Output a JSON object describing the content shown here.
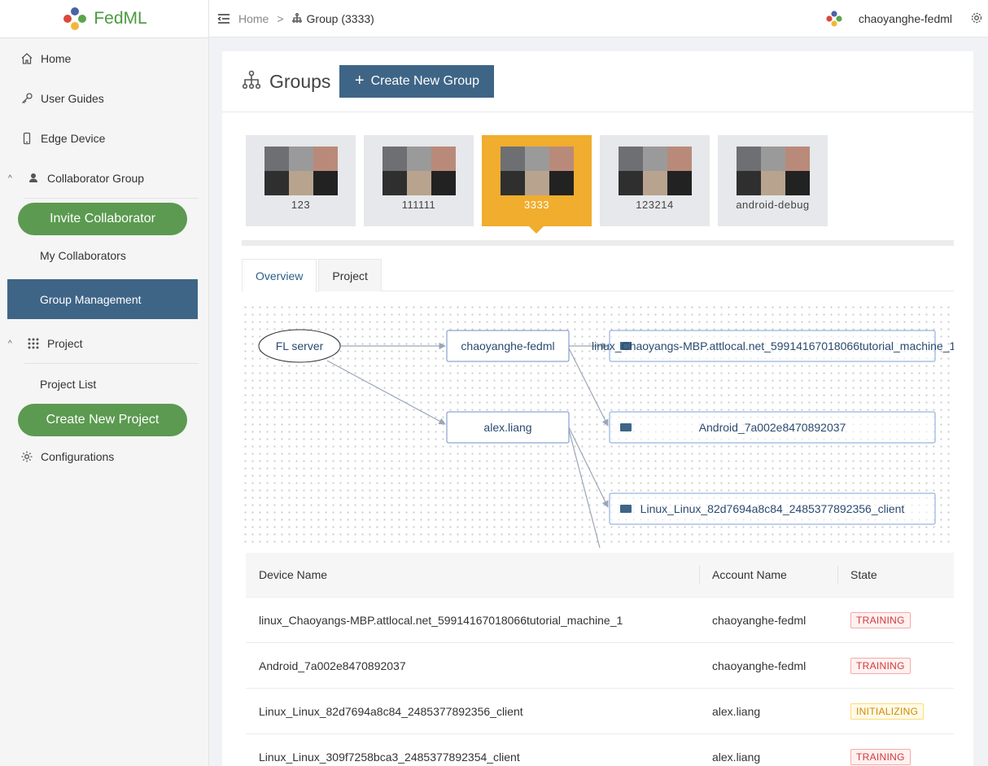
{
  "app": {
    "logo_text": "FedML",
    "brand_colors": {
      "blue": "#4b62a8",
      "green": "#5aa64a",
      "red": "#d9493b",
      "yellow": "#f0b83a"
    }
  },
  "sidebar": {
    "home": "Home",
    "user_guides": "User Guides",
    "edge_device": "Edge Device",
    "collaborator_group": "Collaborator Group",
    "invite_collaborator": "Invite Collaborator",
    "my_collaborators": "My Collaborators",
    "group_management": "Group Management",
    "project": "Project",
    "project_list": "Project List",
    "create_new_project": "Create New Project",
    "configurations": "Configurations"
  },
  "topbar": {
    "home": "Home",
    "separator": ">",
    "current": "Group (3333)",
    "user": "chaoyanghe-fedml"
  },
  "page": {
    "title": "Groups",
    "create_button": "Create New Group"
  },
  "groups": [
    {
      "name": "123",
      "active": false
    },
    {
      "name": "111111",
      "active": false
    },
    {
      "name": "3333",
      "active": true
    },
    {
      "name": "123214",
      "active": false
    },
    {
      "name": "android-debug",
      "active": false
    }
  ],
  "tabs": [
    {
      "label": "Overview",
      "active": true
    },
    {
      "label": "Project",
      "active": false
    }
  ],
  "graph": {
    "server": "FL server",
    "users": [
      "chaoyanghe-fedml",
      "alex.liang"
    ],
    "devices": [
      "linux_Chaoyangs-MBP.attlocal.net_59914167018066tutorial_machine_1",
      "Android_7a002e8470892037",
      "Linux_Linux_82d7694a8c84_2485377892356_client"
    ]
  },
  "table": {
    "headers": {
      "device": "Device Name",
      "account": "Account Name",
      "state": "State"
    },
    "rows": [
      {
        "device": "linux_Chaoyangs-MBP.attlocal.net_59914167018066tutorial_machine_1",
        "account": "chaoyanghe-fedml",
        "state": "TRAINING"
      },
      {
        "device": "Android_7a002e8470892037",
        "account": "chaoyanghe-fedml",
        "state": "TRAINING"
      },
      {
        "device": "Linux_Linux_82d7694a8c84_2485377892356_client",
        "account": "alex.liang",
        "state": "INITIALIZING"
      },
      {
        "device": "Linux_Linux_309f7258bca3_2485377892354_client",
        "account": "alex.liang",
        "state": "TRAINING"
      }
    ]
  },
  "colors": {
    "accent": "#3e6586",
    "green_button": "#5b9a50",
    "active_group": "#f0ad2e",
    "node_border": "#6f8fc4"
  }
}
